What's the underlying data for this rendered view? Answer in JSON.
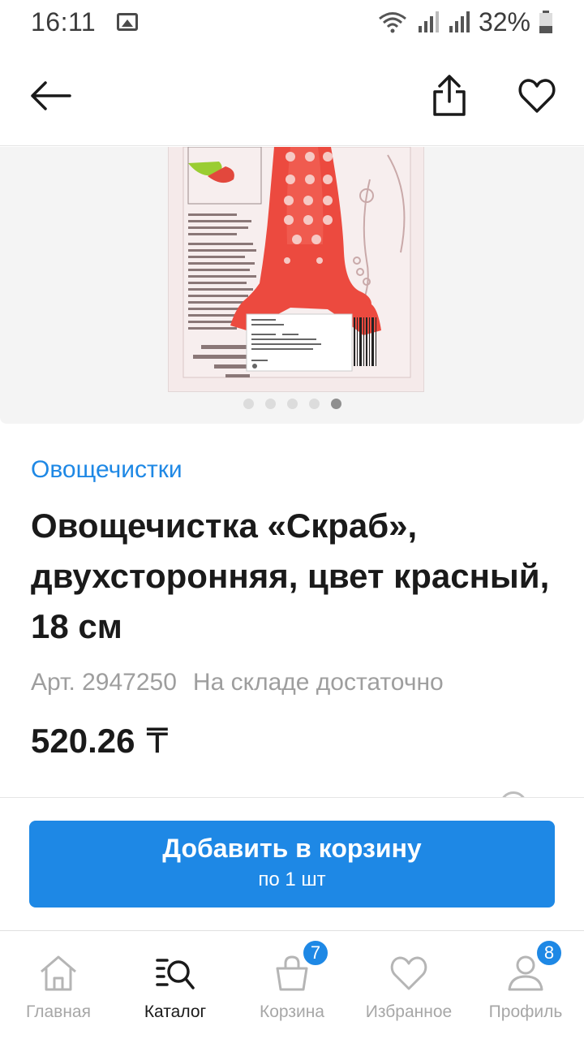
{
  "status_bar": {
    "time": "16:11",
    "battery": "32%"
  },
  "app_bar": {
    "back_icon": "arrow-left-icon",
    "share_icon": "share-icon",
    "favorite_icon": "heart-icon"
  },
  "gallery": {
    "total_images": 5,
    "active_index": 4
  },
  "product": {
    "category": "Овощечистки",
    "title": "Овощечистка «Скраб», двухсторонняя, цвет красный, 18 см",
    "article": "Арт. 2947250",
    "stock": "На складе достаточно",
    "price": "520.26",
    "currency": "₸"
  },
  "cta": {
    "label": "Добавить в корзину",
    "sub_label": "по 1 шт"
  },
  "tabs": [
    {
      "label": "Главная",
      "icon": "home-icon",
      "active": false
    },
    {
      "label": "Каталог",
      "icon": "catalog-search-icon",
      "active": true
    },
    {
      "label": "Корзина",
      "icon": "cart-bag-icon",
      "active": false,
      "badge": "7"
    },
    {
      "label": "Избранное",
      "icon": "heart-icon",
      "active": false
    },
    {
      "label": "Профиль",
      "icon": "profile-icon",
      "active": false,
      "badge": "8"
    }
  ],
  "colors": {
    "accent": "#1e88e5",
    "product_red": "#ec4a3f",
    "inactive_tab": "#a7a7a7"
  }
}
